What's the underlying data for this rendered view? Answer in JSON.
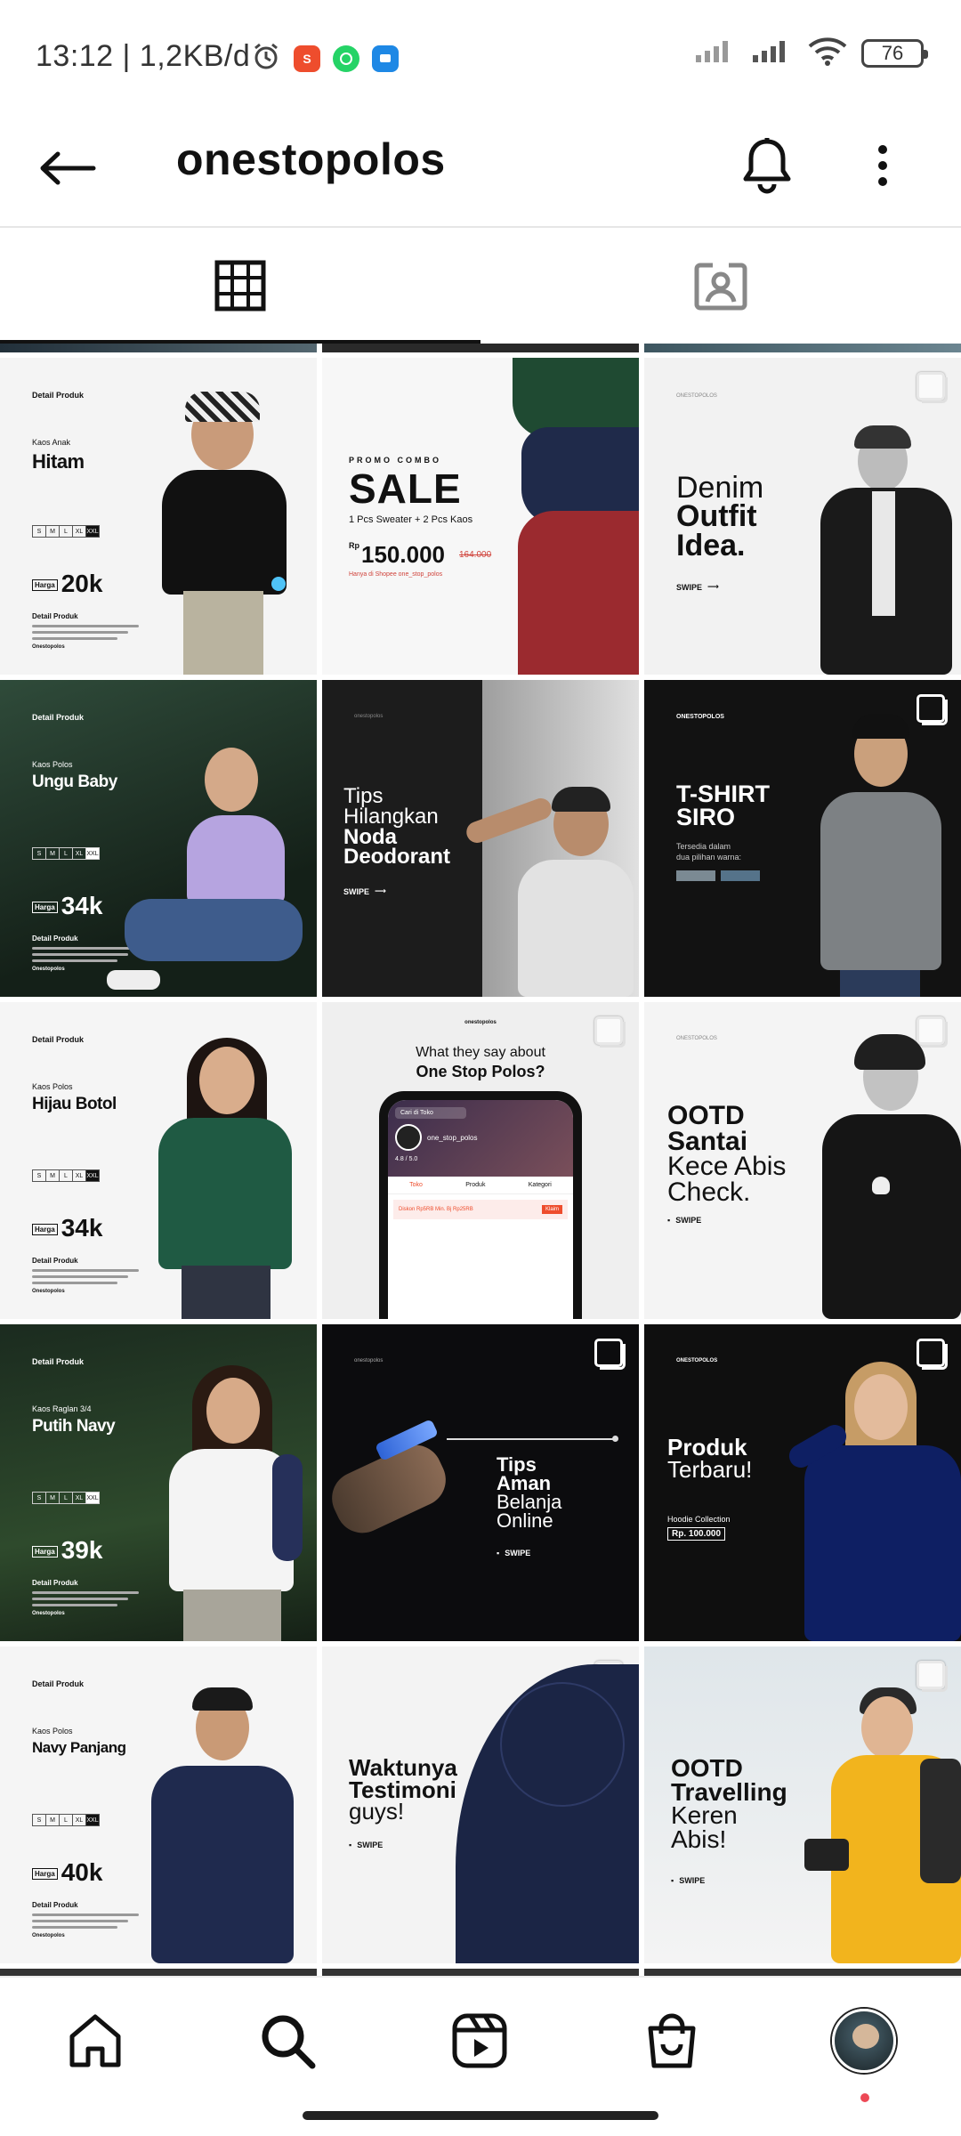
{
  "status_bar": {
    "time": "13:12 | 1,2KB/d",
    "battery": "76",
    "app_icons": [
      "alarm-icon",
      "shopee-icon",
      "whatsapp-icon",
      "messages-icon"
    ]
  },
  "header": {
    "username": "onestopolos",
    "back_icon": "back-arrow-icon",
    "bell_icon": "bell-icon",
    "more_icon": "more-vertical-icon"
  },
  "tabs": [
    {
      "name": "grid",
      "icon": "grid-icon",
      "active": true
    },
    {
      "name": "tagged",
      "icon": "tagged-icon",
      "active": false
    }
  ],
  "posts": {
    "p1": {
      "brand": "Detail Produk",
      "category": "Kaos Anak",
      "name": "Hitam",
      "sizes": [
        "S",
        "M",
        "L",
        "XL",
        "XXL"
      ],
      "price": "20k",
      "price_label": "Harga",
      "detail": "Detail Produk",
      "footer": "Onestopolos"
    },
    "p2": {
      "kicker": "PROMO COMBO",
      "title": "SALE",
      "subtitle": "1 Pcs Sweater + 2 Pcs Kaos",
      "currency": "Rp",
      "price": "150.000",
      "old_price": "164.000",
      "note": "Hanya di Shopee one_stop_polos"
    },
    "p3": {
      "brand": "ONESTOPOLOS",
      "line1": "Denim",
      "line2": "Outfit",
      "line3": "Idea.",
      "swipe": "SWIPE"
    },
    "p4": {
      "brand": "Detail Produk",
      "category": "Kaos Polos",
      "name": "Ungu Baby",
      "sizes": [
        "S",
        "M",
        "L",
        "XL",
        "XXL"
      ],
      "price": "34k",
      "price_label": "Harga",
      "detail": "Detail Produk",
      "footer": "Onestopolos"
    },
    "p5": {
      "brand": "onestopolos",
      "line1": "Tips",
      "line2": "Hilangkan",
      "line3": "Noda",
      "line4": "Deodorant",
      "swipe": "SWIPE"
    },
    "p6": {
      "brand": "ONESTOPOLOS",
      "line1": "T-SHIRT",
      "line2": "SIRO",
      "sub1": "Tersedia dalam",
      "sub2": "dua pilihan warna:"
    },
    "p7": {
      "brand": "Detail Produk",
      "category": "Kaos Polos",
      "name": "Hijau Botol",
      "sizes": [
        "S",
        "M",
        "L",
        "XL",
        "XXL"
      ],
      "price": "34k",
      "price_label": "Harga",
      "detail": "Detail Produk",
      "footer": "Onestopolos"
    },
    "p8": {
      "brand": "onestopolos",
      "q1": "What they say about",
      "q2": "One Stop Polos?",
      "shop": "one_stop_polos",
      "search": "Cari di Toko",
      "rating": "4.8 / 5.0",
      "tabs": [
        "Toko",
        "Produk",
        "Kategori"
      ],
      "voucher": "Diskon Rp5RB Min. Bj Rp25RB",
      "claim": "Klaim"
    },
    "p9": {
      "brand": "ONESTOPOLOS",
      "line1": "OOTD",
      "line2": "Santai",
      "line3": "Kece Abis",
      "line4": "Check.",
      "swipe": "SWIPE"
    },
    "p10": {
      "brand": "Detail Produk",
      "category": "Kaos Raglan 3/4",
      "name": "Putih Navy",
      "sizes": [
        "S",
        "M",
        "L",
        "XL",
        "XXL"
      ],
      "price": "39k",
      "price_label": "Harga",
      "detail": "Detail Produk",
      "footer": "Onestopolos"
    },
    "p11": {
      "brand": "onestopolos",
      "line1": "Tips",
      "line2": "Aman",
      "line3": "Belanja",
      "line4": "Online",
      "swipe": "SWIPE"
    },
    "p12": {
      "brand": "ONESTOPOLOS",
      "line1": "Produk",
      "line2": "Terbaru!",
      "sub": "Hoodie Collection",
      "price": "Rp. 100.000"
    },
    "p13": {
      "brand": "Detail Produk",
      "category": "Kaos Polos",
      "name": "Navy Panjang",
      "sizes": [
        "S",
        "M",
        "L",
        "XL",
        "XXL"
      ],
      "price": "40k",
      "price_label": "Harga",
      "detail": "Detail Produk",
      "footer": "Onestopolos"
    },
    "p14": {
      "line1": "Waktunya",
      "line2": "Testimoni",
      "line3": "guys!",
      "swipe": "SWIPE"
    },
    "p15": {
      "line1": "OOTD",
      "line2": "Travelling",
      "line3": "Keren",
      "line4": "Abis!",
      "swipe": "SWIPE"
    }
  },
  "bottom_nav": [
    {
      "name": "home",
      "icon": "home-icon"
    },
    {
      "name": "search",
      "icon": "search-icon",
      "active": true
    },
    {
      "name": "reels",
      "icon": "reels-icon"
    },
    {
      "name": "shop",
      "icon": "shop-icon"
    },
    {
      "name": "profile",
      "icon": "profile-avatar"
    }
  ],
  "colors": {
    "accent": "#ed4956",
    "text": "#111111",
    "divider": "#e6e6e6"
  }
}
